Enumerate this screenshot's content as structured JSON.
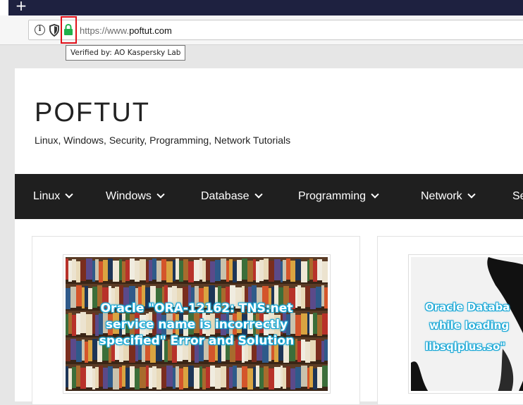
{
  "browser": {
    "new_tab_glyph": "+",
    "url": {
      "scheme": "https://www.",
      "host": "poftut.com"
    },
    "tooltip": "Verified by: AO Kaspersky Lab",
    "icons": [
      "info-icon",
      "tracking-shield-icon",
      "lock-icon",
      "new-tab-icon"
    ],
    "lock_color": "#22b14c",
    "highlight_color": "#e0101a"
  },
  "site": {
    "title": "POFTUT",
    "tagline": "Linux, Windows, Security, Programming, Network Tutorials"
  },
  "nav": {
    "items": [
      {
        "label": "Linux"
      },
      {
        "label": "Windows"
      },
      {
        "label": "Database"
      },
      {
        "label": "Programming"
      },
      {
        "label": "Network"
      },
      {
        "label": "Se"
      }
    ]
  },
  "posts": [
    {
      "thumb_lines": [
        "Oracle \"ORA-12162: TNS:net",
        "service name is incorrectly",
        "specified\" Error and Solution"
      ]
    },
    {
      "thumb_lines": [
        "Oracle Databa",
        "while loading",
        "libsqlplus.so\""
      ]
    }
  ],
  "colors": {
    "nav_bg": "#1f1f1f",
    "tab_strip": "#1e2140",
    "thumb_text_glow": "#17a7d6"
  }
}
